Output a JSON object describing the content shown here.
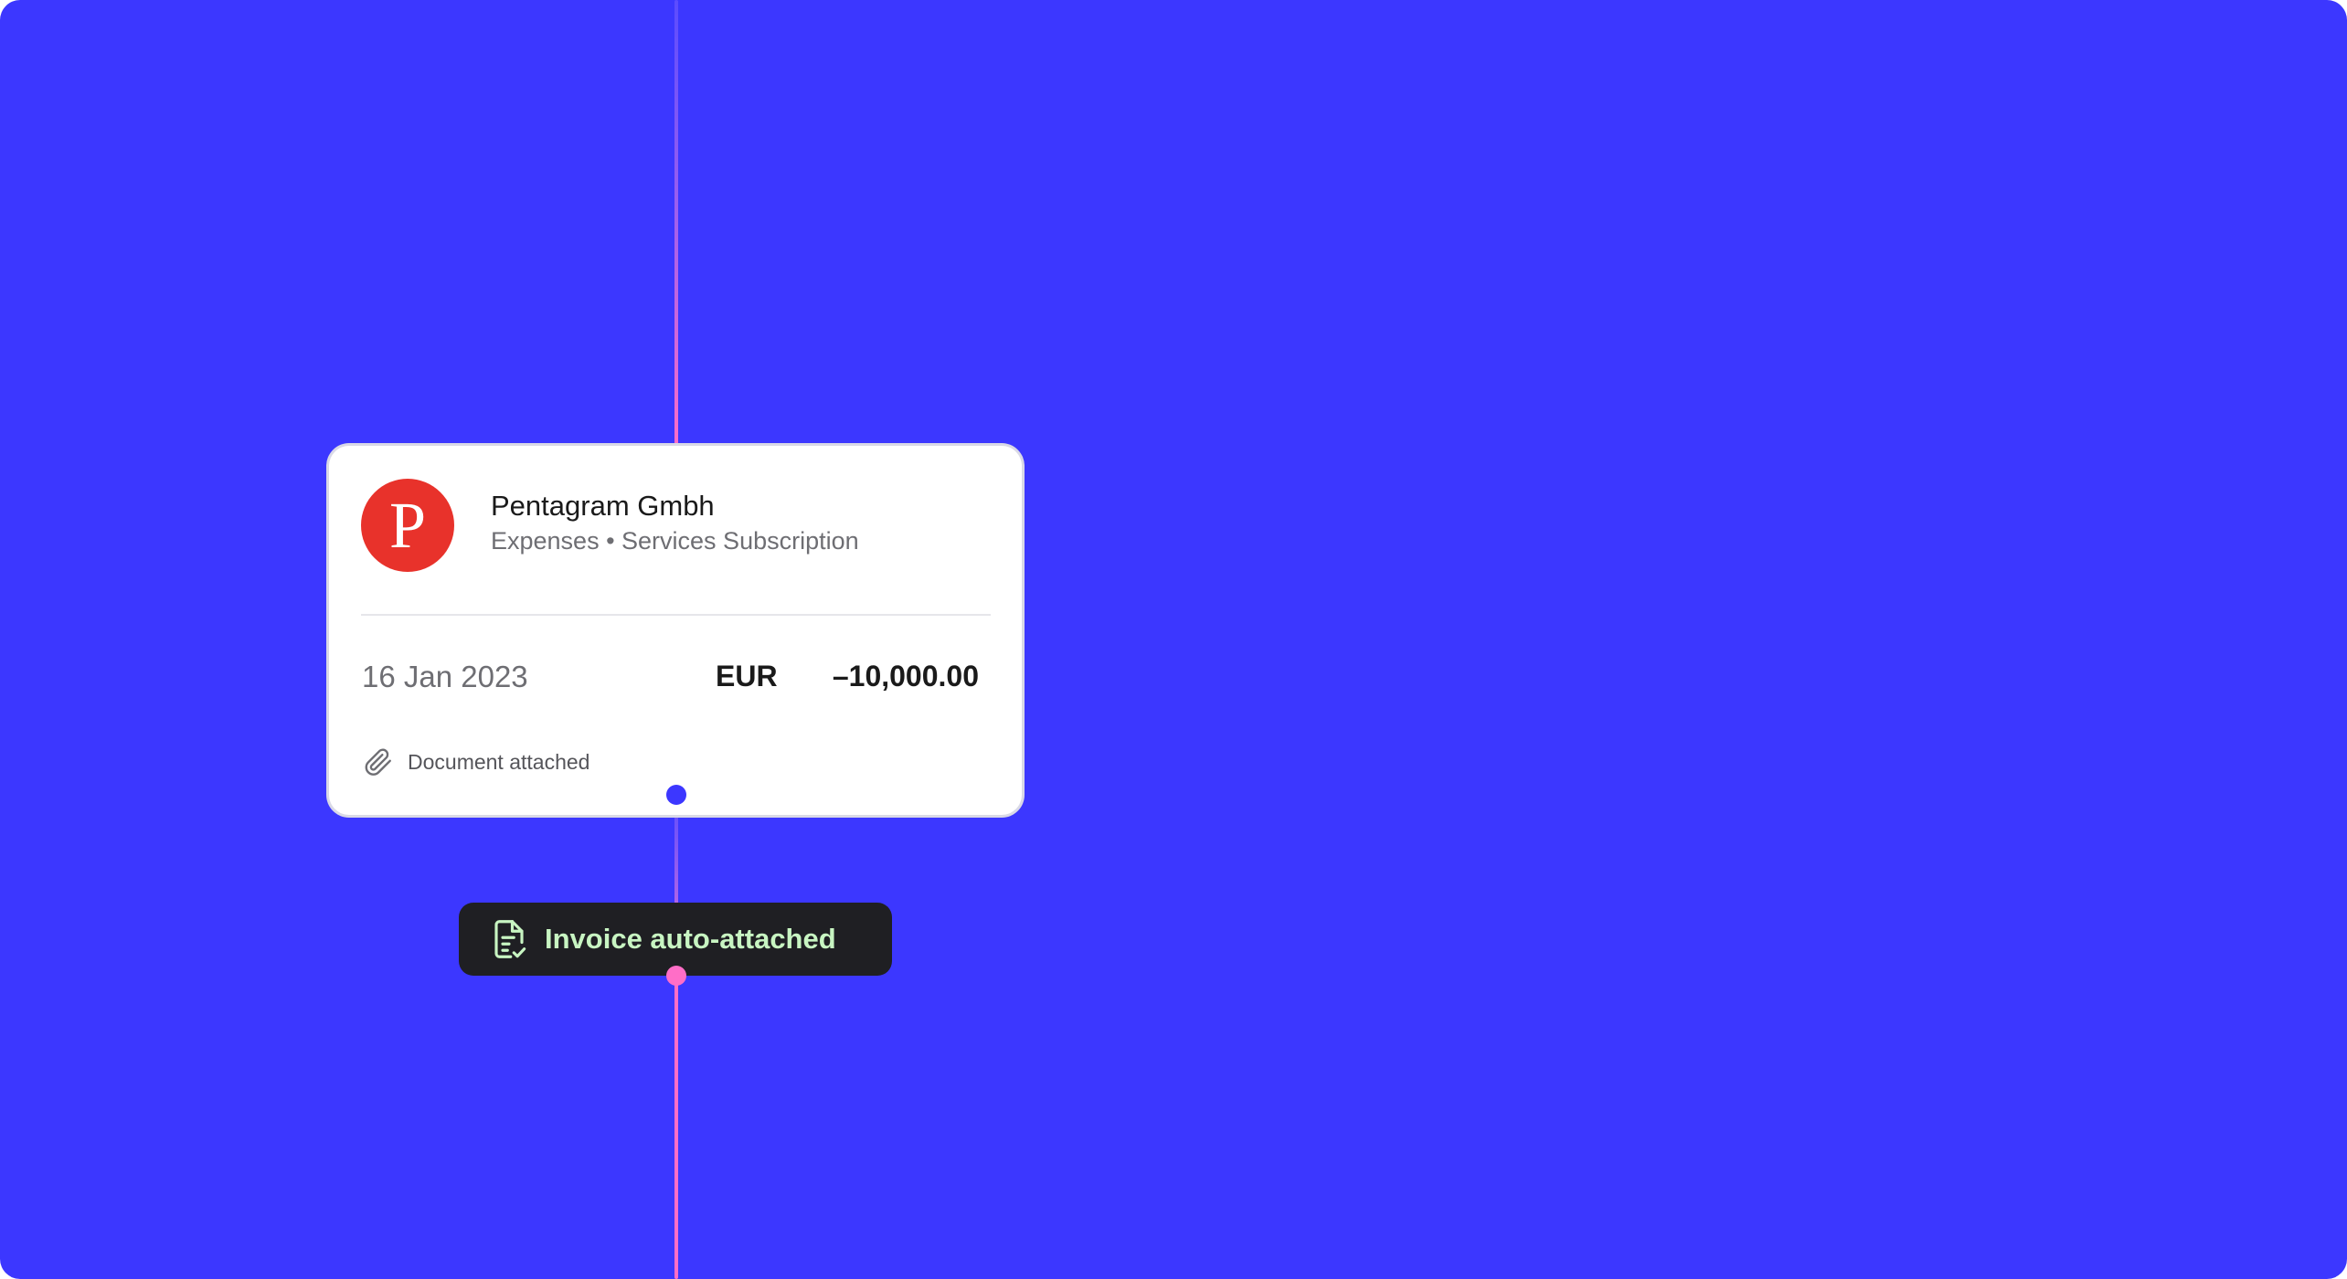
{
  "colors": {
    "background": "#3c37ff",
    "logo": "#e8322b",
    "badge_bg": "#1f1f23",
    "badge_text": "#c8f5c2",
    "timeline_pink": "#ff6ec7"
  },
  "transaction": {
    "logo_letter": "P",
    "merchant": "Pentagram Gmbh",
    "category": "Expenses • Services Subscription",
    "date": "16 Jan 2023",
    "currency": "EUR",
    "amount": "–10,000.00",
    "document_status": "Document attached",
    "document_icon": "paperclip-icon"
  },
  "badge": {
    "icon": "document-check-icon",
    "label": "Invoice auto-attached"
  }
}
